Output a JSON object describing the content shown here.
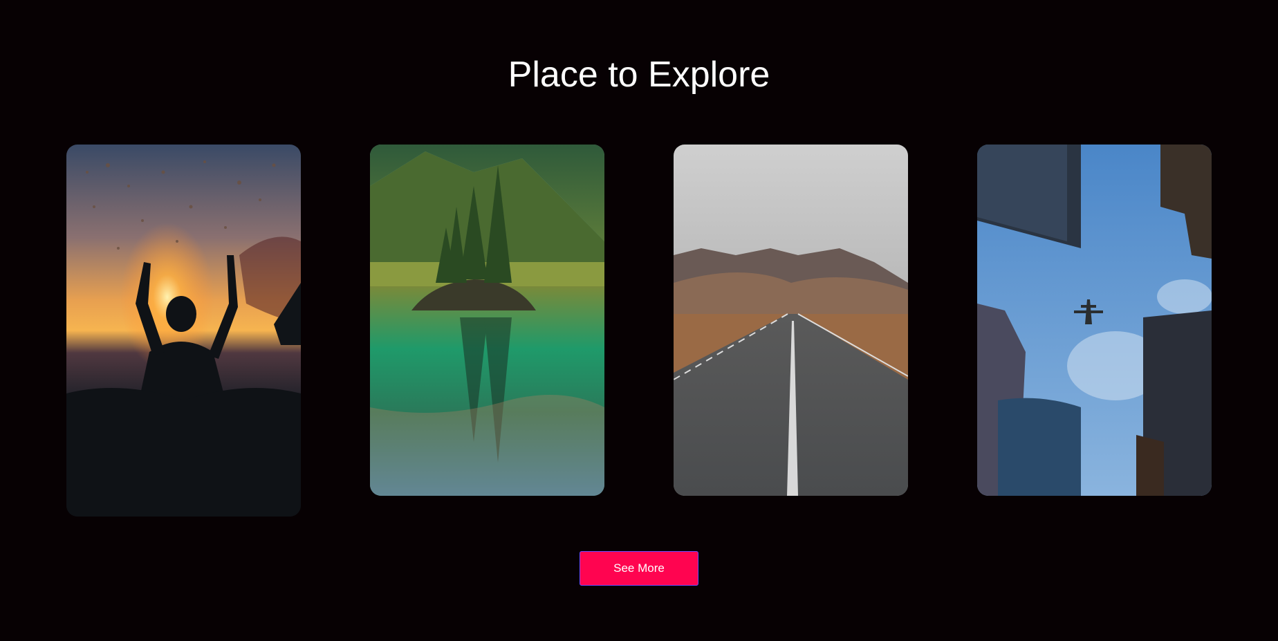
{
  "section": {
    "title": "Place to Explore"
  },
  "cards": [
    {
      "subject": "swimmer-sunset-splash"
    },
    {
      "subject": "mountain-lake-island"
    },
    {
      "subject": "mountain-road"
    },
    {
      "subject": "skyscrapers-airplane"
    }
  ],
  "actions": {
    "see_more_label": "See More"
  },
  "colors": {
    "background": "#070103",
    "button": "#ff0450",
    "button_border": "#6a4cff",
    "text": "#ffffff"
  }
}
